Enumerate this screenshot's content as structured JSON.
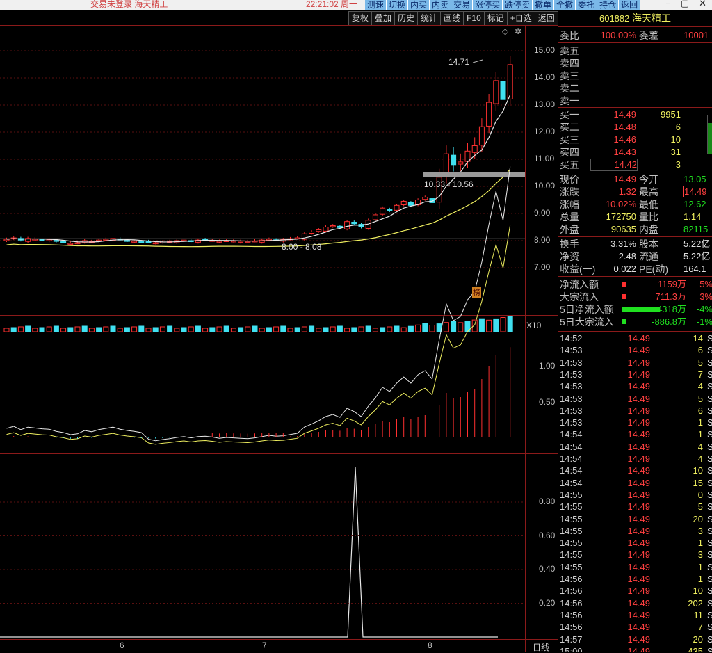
{
  "titlebar": {
    "left_text": "交易未登录    海天精工",
    "time_text": "22:21:02  周一",
    "buttons": [
      "测速",
      "切换",
      "内买",
      "内卖",
      "交易",
      "涨停买",
      "跌停卖",
      "撤单",
      "全撤",
      "委托",
      "持仓",
      "返回"
    ]
  },
  "toolbar": [
    "复权",
    "叠加",
    "历史",
    "统计",
    "画线",
    "F10",
    "标记",
    "+自选",
    "返回"
  ],
  "chart": {
    "price_axis": [
      "15.00",
      "14.00",
      "13.00",
      "12.00",
      "11.00",
      "10.00",
      "9.00",
      "8.00",
      "7.00"
    ],
    "annotations": {
      "high": "14.71",
      "range1": "10.33 - 10.56",
      "range2": "8.00 - 8.08",
      "badge": "榜"
    },
    "volume_label": "X10",
    "indicator_axis": [
      "1.00",
      "0.50"
    ],
    "bottom_axis": [
      "0.80",
      "0.60",
      "0.40",
      "0.20"
    ],
    "date_labels": [
      "6",
      "7",
      "8"
    ],
    "period": "日线",
    "colors": {
      "up": "#ff3030",
      "down": "#40e0f0",
      "frame": "#8b1a1a",
      "ma_white": "#e8e8e8",
      "ma_yellow": "#f0f060"
    }
  },
  "stock": {
    "code": "601882",
    "name": "海天精工"
  },
  "ratio": {
    "wb_label": "委比",
    "wb_value": "100.00%",
    "wc_label": "委差",
    "wc_value": "10001"
  },
  "asks": [
    "卖五",
    "卖四",
    "卖三",
    "卖二",
    "卖一"
  ],
  "bids": [
    {
      "label": "买一",
      "price": "14.49",
      "vol": "9951"
    },
    {
      "label": "买二",
      "price": "14.48",
      "vol": "6"
    },
    {
      "label": "买三",
      "price": "14.46",
      "vol": "10"
    },
    {
      "label": "买四",
      "price": "14.43",
      "vol": "31"
    },
    {
      "label": "买五",
      "price": "14.42",
      "vol": "3"
    }
  ],
  "quote": [
    {
      "l1": "现价",
      "v1": "14.49",
      "l2": "今开",
      "v2": "13.05"
    },
    {
      "l1": "涨跌",
      "v1": "1.32",
      "l2": "最高",
      "v2": "14.49"
    },
    {
      "l1": "涨幅",
      "v1": "10.02%",
      "l2": "最低",
      "v2": "12.62"
    },
    {
      "l1": "总量",
      "v1": "172750",
      "l2": "量比",
      "v2": "1.14"
    },
    {
      "l1": "外盘",
      "v1": "90635",
      "l2": "内盘",
      "v2": "82115"
    }
  ],
  "fund": [
    {
      "l1": "换手",
      "v1": "3.31%",
      "l2": "股本",
      "v2": "5.22亿"
    },
    {
      "l1": "净资",
      "v1": "2.48",
      "l2": "流通",
      "v2": "5.22亿"
    },
    {
      "l1": "收益(一)",
      "v1": "0.022",
      "l2": "PE(动)",
      "v2": "164.1"
    }
  ],
  "flows": [
    {
      "label": "净流入额",
      "value": "1159万",
      "pct": "5%",
      "bar_color": "#ff3030",
      "bar_frac": 0.05
    },
    {
      "label": "大宗流入",
      "value": "711.3万",
      "pct": "3%",
      "bar_color": "#ff3030",
      "bar_frac": 0.03
    },
    {
      "label": "5日净流入额",
      "value": "-4318万",
      "pct": "-4%",
      "bar_color": "#20e020",
      "bar_frac": 0.9
    },
    {
      "label": "5日大宗流入",
      "value": "-886.8万",
      "pct": "-1%",
      "bar_color": "#20e020",
      "bar_frac": 0.05
    }
  ],
  "ticks": [
    {
      "t": "14:52",
      "p": "14.49",
      "v": "14",
      "s": "S"
    },
    {
      "t": "14:53",
      "p": "14.49",
      "v": "6",
      "s": "S"
    },
    {
      "t": "14:53",
      "p": "14.49",
      "v": "5",
      "s": "S"
    },
    {
      "t": "14:53",
      "p": "14.49",
      "v": "7",
      "s": "S"
    },
    {
      "t": "14:53",
      "p": "14.49",
      "v": "4",
      "s": "S"
    },
    {
      "t": "14:53",
      "p": "14.49",
      "v": "5",
      "s": "S"
    },
    {
      "t": "14:53",
      "p": "14.49",
      "v": "6",
      "s": "S"
    },
    {
      "t": "14:53",
      "p": "14.49",
      "v": "1",
      "s": "S"
    },
    {
      "t": "14:54",
      "p": "14.49",
      "v": "1",
      "s": "S"
    },
    {
      "t": "14:54",
      "p": "14.49",
      "v": "4",
      "s": "S"
    },
    {
      "t": "14:54",
      "p": "14.49",
      "v": "4",
      "s": "S"
    },
    {
      "t": "14:54",
      "p": "14.49",
      "v": "10",
      "s": "S"
    },
    {
      "t": "14:54",
      "p": "14.49",
      "v": "15",
      "s": "S"
    },
    {
      "t": "14:55",
      "p": "14.49",
      "v": "0",
      "s": "S"
    },
    {
      "t": "14:55",
      "p": "14.49",
      "v": "5",
      "s": "S"
    },
    {
      "t": "14:55",
      "p": "14.49",
      "v": "20",
      "s": "S"
    },
    {
      "t": "14:55",
      "p": "14.49",
      "v": "3",
      "s": "S"
    },
    {
      "t": "14:55",
      "p": "14.49",
      "v": "1",
      "s": "S"
    },
    {
      "t": "14:55",
      "p": "14.49",
      "v": "3",
      "s": "S"
    },
    {
      "t": "14:55",
      "p": "14.49",
      "v": "1",
      "s": "S"
    },
    {
      "t": "14:56",
      "p": "14.49",
      "v": "1",
      "s": "S"
    },
    {
      "t": "14:56",
      "p": "14.49",
      "v": "10",
      "s": "S"
    },
    {
      "t": "14:56",
      "p": "14.49",
      "v": "202",
      "s": "S"
    },
    {
      "t": "14:56",
      "p": "14.49",
      "v": "11",
      "s": "S"
    },
    {
      "t": "14:56",
      "p": "14.49",
      "v": "7",
      "s": "S"
    },
    {
      "t": "14:57",
      "p": "14.49",
      "v": "20",
      "s": "S"
    },
    {
      "t": "15:00",
      "p": "14.49",
      "v": "435",
      "s": "S"
    }
  ]
}
